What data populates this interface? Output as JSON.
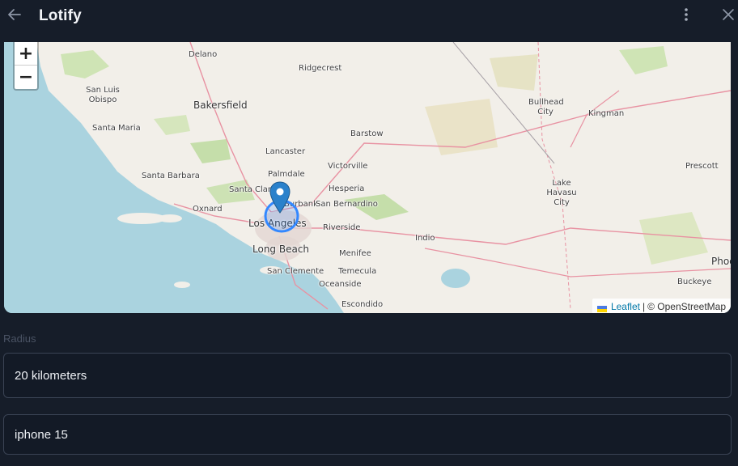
{
  "header": {
    "title": "Lotify",
    "back_icon": "arrow-left-icon",
    "more_icon": "more-vertical-icon",
    "close_icon": "close-icon"
  },
  "map": {
    "zoom_in_label": "+",
    "zoom_out_label": "−",
    "places": [
      {
        "name": "Delano",
        "big": false
      },
      {
        "name": "Ridgecrest",
        "big": false
      },
      {
        "name": "San Luis Obispo",
        "big": false
      },
      {
        "name": "Bakersfield",
        "big": true
      },
      {
        "name": "Bullhead City",
        "big": false
      },
      {
        "name": "Kingman",
        "big": false
      },
      {
        "name": "Santa Maria",
        "big": false
      },
      {
        "name": "Barstow",
        "big": false
      },
      {
        "name": "Lancaster",
        "big": false
      },
      {
        "name": "Prescott",
        "big": false
      },
      {
        "name": "Santa Barbara",
        "big": false
      },
      {
        "name": "Palmdale",
        "big": false
      },
      {
        "name": "Victorville",
        "big": false
      },
      {
        "name": "Santa Clarita",
        "big": false
      },
      {
        "name": "Burbank",
        "big": false
      },
      {
        "name": "Hesperia",
        "big": false
      },
      {
        "name": "Lake Havasu City",
        "big": false
      },
      {
        "name": "Oxnard",
        "big": false
      },
      {
        "name": "San Bernardino",
        "big": false
      },
      {
        "name": "Los Angeles",
        "big": true
      },
      {
        "name": "Riverside",
        "big": false
      },
      {
        "name": "Indio",
        "big": false
      },
      {
        "name": "Long Beach",
        "big": true
      },
      {
        "name": "Menifee",
        "big": false
      },
      {
        "name": "Phoenix",
        "big": true
      },
      {
        "name": "San Clemente",
        "big": false
      },
      {
        "name": "Temecula",
        "big": false
      },
      {
        "name": "Buckeye",
        "big": false
      },
      {
        "name": "Oceanside",
        "big": false
      },
      {
        "name": "Escondido",
        "big": false
      }
    ],
    "marker_icon": "map-pin-icon",
    "attribution": {
      "leaflet": "Leaflet",
      "separator": "|",
      "osm": "© OpenStreetMap"
    },
    "colors": {
      "water": "#aad3df",
      "land": "#f2efe9",
      "marker": "#2a81cb",
      "radius_circle": "#3388ff"
    }
  },
  "form": {
    "radius_label": "Radius",
    "radius_value": "20 kilometers",
    "query_value": "iphone 15"
  }
}
